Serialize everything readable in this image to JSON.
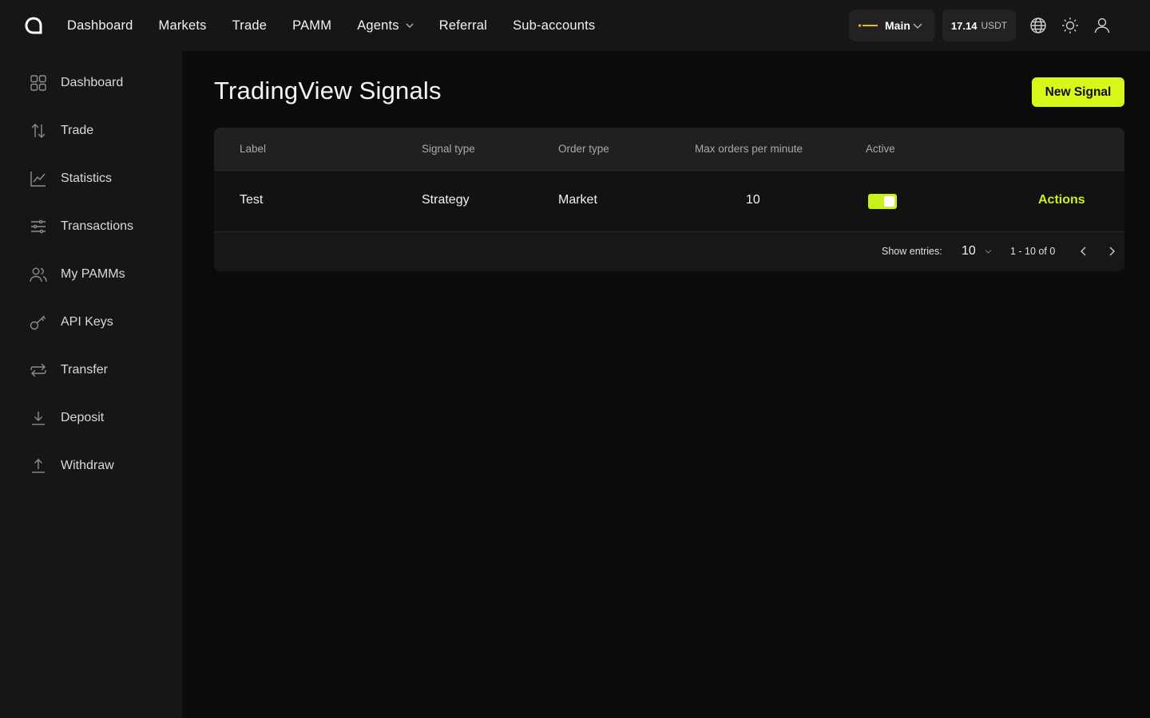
{
  "topnav": {
    "items": [
      "Dashboard",
      "Markets",
      "Trade",
      "PAMM",
      "Agents",
      "Referral",
      "Sub-accounts"
    ]
  },
  "account": {
    "name": "Main",
    "exchange_logo": "binance-logo"
  },
  "balance": {
    "value": "17.14",
    "currency": "USDT"
  },
  "sidebar": {
    "items": [
      {
        "label": "Dashboard",
        "icon": "grid-icon"
      },
      {
        "label": "Trade",
        "icon": "arrows-updown-icon"
      },
      {
        "label": "Statistics",
        "icon": "chart-line-icon"
      },
      {
        "label": "Transactions",
        "icon": "sliders-icon"
      },
      {
        "label": "My PAMMs",
        "icon": "users-icon"
      },
      {
        "label": "API Keys",
        "icon": "key-icon"
      },
      {
        "label": "Transfer",
        "icon": "transfer-icon"
      },
      {
        "label": "Deposit",
        "icon": "download-icon"
      },
      {
        "label": "Withdraw",
        "icon": "upload-icon"
      }
    ]
  },
  "page": {
    "title": "TradingView Signals",
    "new_button": "New Signal"
  },
  "table": {
    "columns": [
      "Label",
      "Signal type",
      "Order type",
      "Max orders per minute",
      "Active"
    ],
    "rows": [
      {
        "label": "Test",
        "signal_type": "Strategy",
        "order_type": "Market",
        "max_orders": "10",
        "active": true,
        "actions": "Actions"
      }
    ],
    "footer": {
      "show_entries_label": "Show entries:",
      "entries_value": "10",
      "range": "1 - 10 of 0"
    }
  },
  "colors": {
    "accent": "#d7f71b",
    "background": "#0b0b0b",
    "panel": "#161616"
  }
}
